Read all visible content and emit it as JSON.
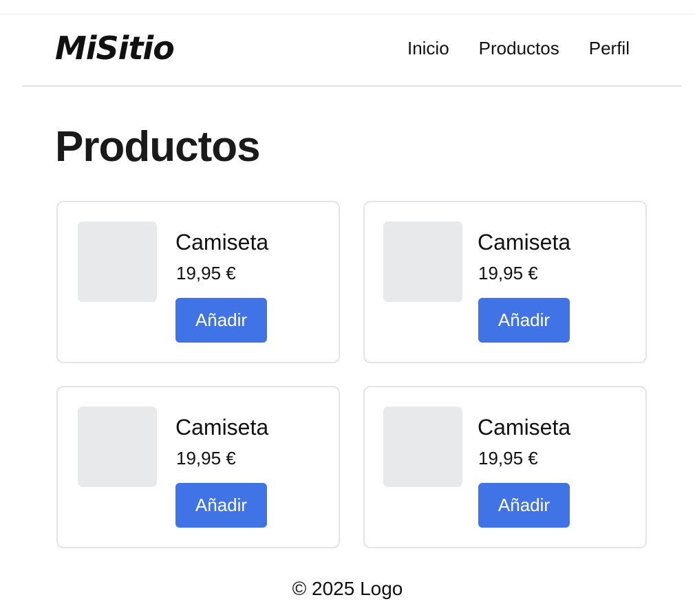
{
  "header": {
    "logo": "MiSitio",
    "nav": [
      {
        "label": "Inicio"
      },
      {
        "label": "Productos"
      },
      {
        "label": "Perfil"
      }
    ]
  },
  "main": {
    "title": "Productos",
    "products": [
      {
        "name": "Camiseta",
        "price": "19,95 €",
        "button": "Añadir"
      },
      {
        "name": "Camiseta",
        "price": "19,95 €",
        "button": "Añadir"
      },
      {
        "name": "Camiseta",
        "price": "19,95 €",
        "button": "Añadir"
      },
      {
        "name": "Camiseta",
        "price": "19,95 €",
        "button": "Añadir"
      }
    ]
  },
  "footer": {
    "text": "© 2025 Logo"
  },
  "colors": {
    "accent": "#3f73e6",
    "thumb_placeholder": "#e8e9eb",
    "card_border": "#e4e4e6"
  }
}
